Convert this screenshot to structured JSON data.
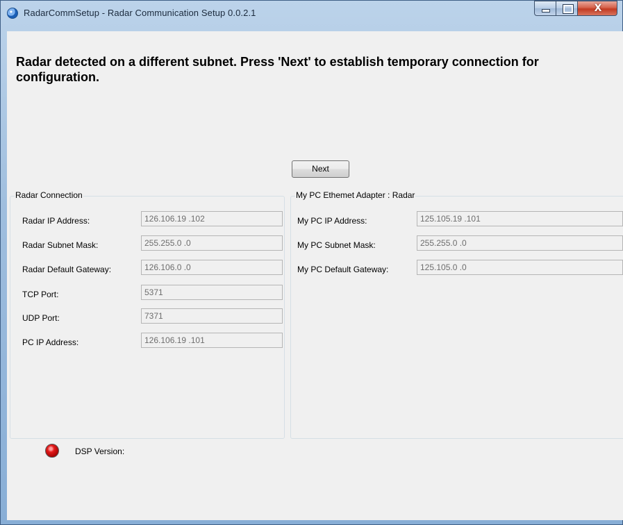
{
  "window": {
    "title": "RadarCommSetup - Radar Communication  Setup 0.0.2.1",
    "close_glyph": "X"
  },
  "message": "Radar detected on a different subnet. Press 'Next' to establish temporary connection for configuration.",
  "next_button": "Next",
  "radar_connection": {
    "legend": "Radar Connection",
    "rows": [
      {
        "label": "Radar IP Address:",
        "value": "126.106.19 .102"
      },
      {
        "label": "Radar Subnet Mask:",
        "value": "255.255.0  .0"
      },
      {
        "label": "Radar Default Gateway:",
        "value": "126.106.0  .0"
      },
      {
        "label": "TCP Port:",
        "value": "5371"
      },
      {
        "label": "UDP Port:",
        "value": "7371"
      },
      {
        "label": "PC IP Address:",
        "value": "126.106.19 .101"
      }
    ]
  },
  "pc_adapter": {
    "legend": "My PC Ethemet Adapter : Radar",
    "rows": [
      {
        "label": "My PC IP Address:",
        "value": "125.105.19 .101"
      },
      {
        "label": "My PC Subnet Mask:",
        "value": "255.255.0  .0"
      },
      {
        "label": "My PC Default Gateway:",
        "value": "125.105.0  .0"
      }
    ]
  },
  "status": {
    "dsp_label": "DSP Version:",
    "led_color": "#d81818"
  }
}
